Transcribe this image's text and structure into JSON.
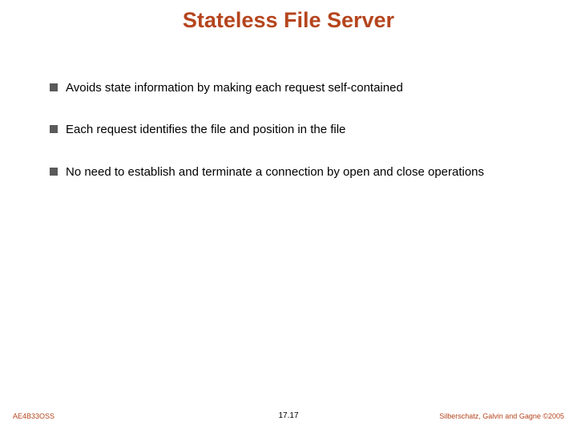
{
  "title": "Stateless File Server",
  "bullets": [
    "Avoids state information by making each request self-contained",
    "Each request identifies the file and position in the file",
    "No need to establish and terminate a connection by open and close operations"
  ],
  "footer": {
    "left": "AE4B33OSS",
    "center": "17.17",
    "right": "Silberschatz, Galvin and Gagne ©2005"
  }
}
